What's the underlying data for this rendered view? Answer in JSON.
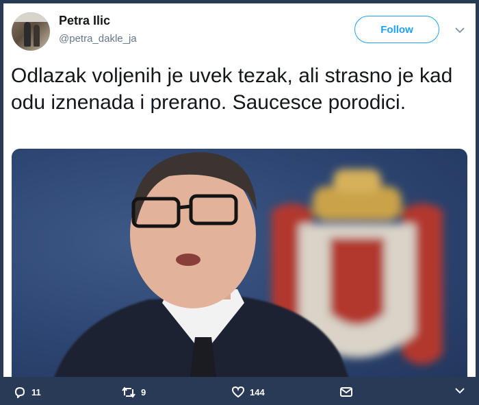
{
  "user": {
    "name": "Petra Ilic",
    "handle": "@petra_dakle_ja"
  },
  "follow_label": "Follow",
  "tweet": {
    "text": "Odlazak voljenih je uvek tezak, ali strasno je kad odu iznenada i prerano. Saucesce porodici."
  },
  "actions": {
    "replies": "11",
    "retweets": "9",
    "likes": "144"
  },
  "icons": [
    "reply-icon",
    "retweet-icon",
    "like-icon",
    "message-icon",
    "chevron-down-icon"
  ],
  "colors": {
    "accent": "#1da1f2",
    "background": "#283a55",
    "text": "#14171a",
    "secondary_text": "#657786"
  }
}
